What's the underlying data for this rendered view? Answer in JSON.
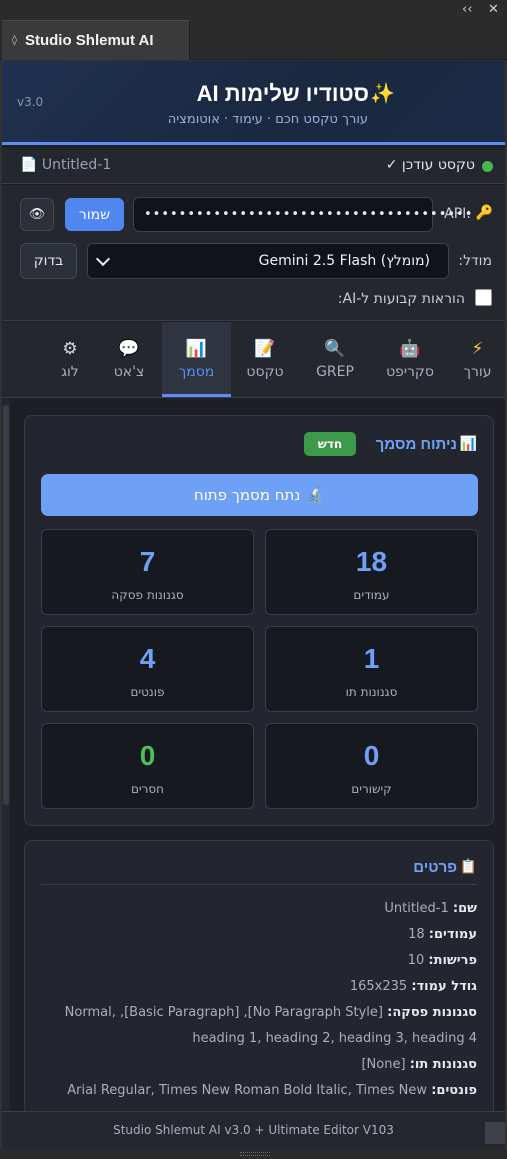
{
  "window": {
    "collapse_icon": "double-chevron-icon",
    "close_icon": "close-icon",
    "panel_tab_title": "Studio Shlemut AI"
  },
  "header": {
    "version": "v3.0",
    "title": "סטודיו שלימות AI",
    "sparkle": "✨",
    "subtitle": "עורך טקסט חכם · עימוד · אוטומציה"
  },
  "status": {
    "text": "טקסט עודכן ✓",
    "doc_name": "Untitled-1",
    "dot_color": "#46b64f"
  },
  "settings": {
    "api_label": "API:",
    "api_value": "••••••••••••••••••••••••••••••••••••••",
    "save_label": "שמור",
    "eye_label": "👁",
    "model_label": "מודל:",
    "model_value": "Gemini 2.5 Flash (מומלץ)",
    "check_label": "בדוק",
    "fixed_instructions_label": "הוראות קבועות ל-AI:"
  },
  "tabs": [
    {
      "label": "עורך",
      "icon": "⚡"
    },
    {
      "label": "סקריפט",
      "icon": "🤖"
    },
    {
      "label": "GREP",
      "icon": "🔍"
    },
    {
      "label": "טקסט",
      "icon": "📝"
    },
    {
      "label": "מסמך",
      "icon": "📊"
    },
    {
      "label": "צ'אט",
      "icon": "💬"
    },
    {
      "label": "לוג",
      "icon": "⚙"
    }
  ],
  "analysis": {
    "title": "ניתוח מסמך",
    "icon": "📊",
    "badge": "חדש",
    "button_label": "נתח מסמך פתוח",
    "button_icon": "🔬",
    "stats": [
      {
        "value": "18",
        "label": "עמודים"
      },
      {
        "value": "7",
        "label": "סגנונות פסקה"
      },
      {
        "value": "1",
        "label": "סגנונות תו"
      },
      {
        "value": "4",
        "label": "פונטים"
      },
      {
        "value": "0",
        "label": "קישורים"
      },
      {
        "value": "0",
        "label": "חסרים"
      }
    ]
  },
  "details": {
    "title": "פרטים",
    "icon": "📋",
    "rows": [
      {
        "key": "שם:",
        "value": "Untitled-1"
      },
      {
        "key": "עמודים:",
        "value": "18"
      },
      {
        "key": "פרישות:",
        "value": "10"
      },
      {
        "key": "גודל עמוד:",
        "value": "165x235"
      },
      {
        "key": "סגנונות פסקה:",
        "value": "[No Paragraph Style], [Basic Paragraph], Normal, heading 1, heading 2, heading 3, heading 4"
      },
      {
        "key": "סגנונות תו:",
        "value": "[None]"
      },
      {
        "key": "פונטים:",
        "value": "Arial Regular, Times New Roman Bold Italic, Times New"
      }
    ]
  },
  "footer": {
    "text": "Studio Shlemut AI v3.0 + Ultimate Editor V103"
  },
  "colors": {
    "accent": "#5b8ef2",
    "success": "#46b64f",
    "background": "#1d1f24"
  }
}
